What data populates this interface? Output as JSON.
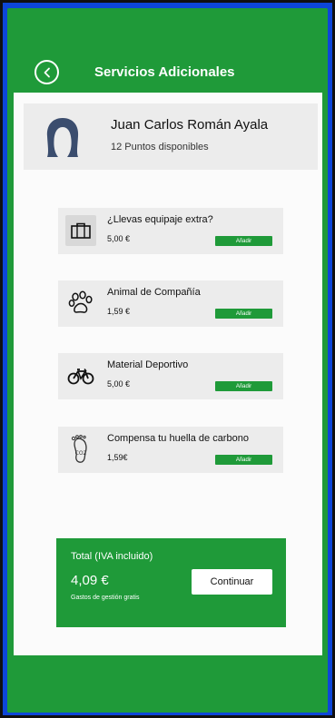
{
  "header": {
    "title": "Servicios Adicionales",
    "back_icon": "chevron-left-circle-icon"
  },
  "profile": {
    "name": "Juan Carlos Román Ayala",
    "points": "12 Puntos disponibles",
    "avatar_icon": "user-avatar-icon"
  },
  "services": [
    {
      "name": "¿Llevas equipaje extra?",
      "price": "5,00 €",
      "add_label": "Añadir",
      "icon": "luggage-icon"
    },
    {
      "name": "Animal de Compañía",
      "price": "1,59 €",
      "add_label": "Añadir",
      "icon": "paw-icon"
    },
    {
      "name": "Material Deportivo",
      "price": "5,00 €",
      "add_label": "Añadir",
      "icon": "bicycle-icon"
    },
    {
      "name": "Compensa tu huella de carbono",
      "price": "1,59€",
      "add_label": "Añadir",
      "icon": "footprint-co2-icon"
    }
  ],
  "total": {
    "label": "Total (IVA incluido)",
    "value": "4,09 €",
    "note": "Gastos de gestión gratis",
    "continue_label": "Continuar"
  },
  "colors": {
    "brand_green": "#1f9a39",
    "panel_grey": "#ececec",
    "avatar_blue": "#3b4d6e",
    "frame_blue": "#0d46d8"
  }
}
